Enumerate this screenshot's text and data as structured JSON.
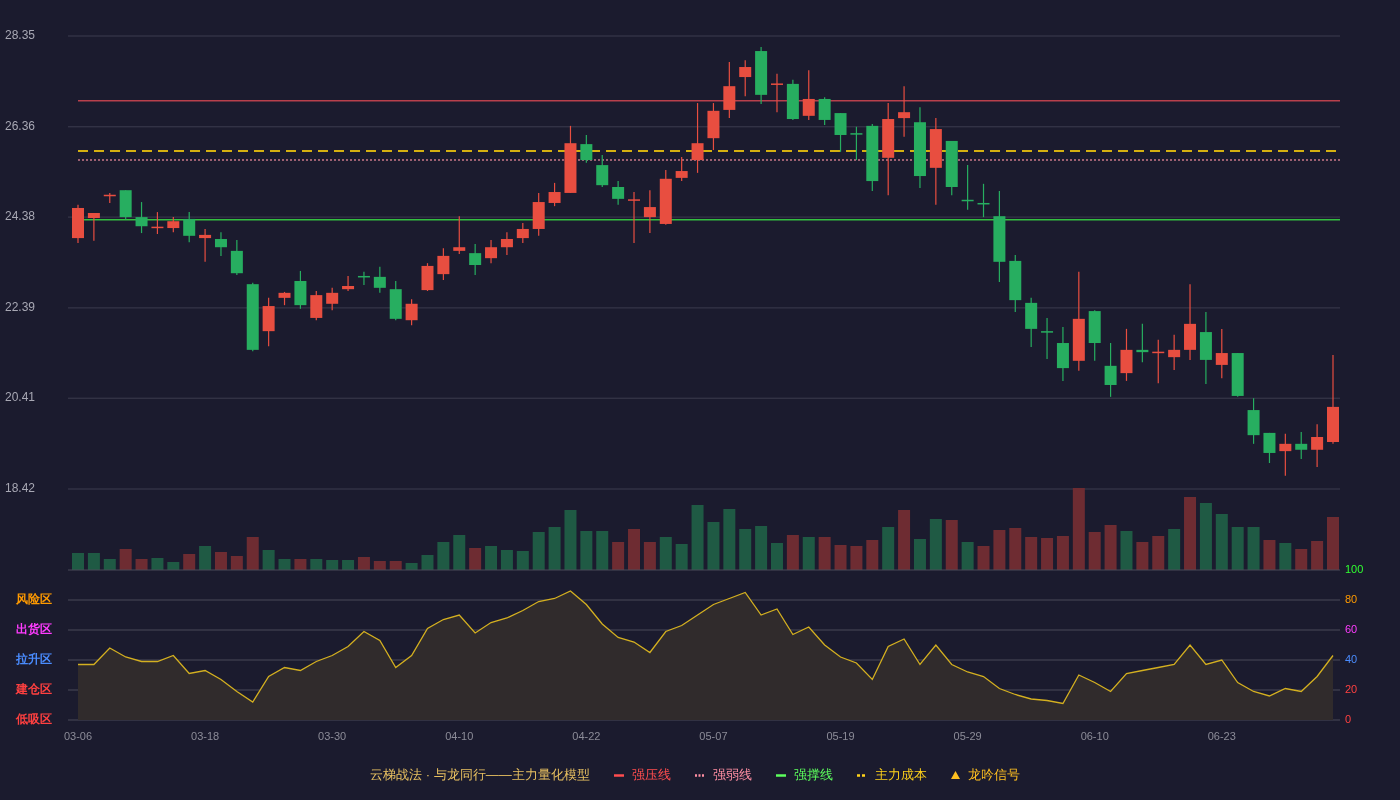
{
  "price_chart": {
    "chart_data": {
      "type": "candlestick",
      "ylim": [
        18.42,
        28.35
      ],
      "yticks": [
        {
          "value": 28.35,
          "label": "28.35"
        },
        {
          "value": 26.36,
          "label": "26.36"
        },
        {
          "value": 24.38,
          "label": "24.38"
        },
        {
          "value": 22.39,
          "label": "22.39"
        },
        {
          "value": 20.41,
          "label": "20.41"
        },
        {
          "value": 18.42,
          "label": "18.42"
        }
      ],
      "grid": true,
      "ohlc": [
        [
          23.92,
          24.65,
          23.81,
          24.58
        ],
        [
          24.36,
          24.47,
          23.86,
          24.47
        ],
        [
          24.86,
          24.91,
          24.69,
          24.87
        ],
        [
          24.97,
          24.97,
          24.32,
          24.38
        ],
        [
          24.38,
          24.71,
          24.03,
          24.18
        ],
        [
          24.16,
          24.49,
          24.01,
          24.17
        ],
        [
          24.14,
          24.38,
          24.05,
          24.29
        ],
        [
          24.34,
          24.49,
          23.83,
          23.97
        ],
        [
          23.92,
          24.12,
          23.4,
          23.99
        ],
        [
          23.9,
          24.05,
          23.53,
          23.72
        ],
        [
          23.64,
          23.88,
          23.11,
          23.15
        ],
        [
          22.91,
          22.94,
          21.44,
          21.47
        ],
        [
          21.88,
          22.61,
          21.55,
          22.43
        ],
        [
          22.61,
          22.74,
          22.45,
          22.72
        ],
        [
          22.98,
          23.2,
          22.37,
          22.45
        ],
        [
          22.17,
          22.76,
          22.12,
          22.67
        ],
        [
          22.48,
          22.83,
          22.34,
          22.72
        ],
        [
          22.8,
          23.09,
          22.76,
          22.87
        ],
        [
          23.09,
          23.18,
          22.89,
          23.08
        ],
        [
          23.07,
          23.29,
          22.72,
          22.83
        ],
        [
          22.8,
          22.98,
          22.12,
          22.15
        ],
        [
          22.12,
          22.58,
          22.01,
          22.48
        ],
        [
          22.78,
          23.37,
          22.76,
          23.31
        ],
        [
          23.13,
          23.7,
          23.0,
          23.53
        ],
        [
          23.64,
          24.4,
          23.57,
          23.72
        ],
        [
          23.59,
          23.79,
          23.11,
          23.33
        ],
        [
          23.48,
          23.88,
          23.37,
          23.72
        ],
        [
          23.72,
          24.05,
          23.55,
          23.9
        ],
        [
          23.92,
          24.25,
          23.81,
          24.12
        ],
        [
          24.12,
          24.91,
          23.97,
          24.71
        ],
        [
          24.69,
          25.13,
          24.62,
          24.93
        ],
        [
          24.91,
          26.38,
          24.91,
          26.0
        ],
        [
          25.98,
          26.18,
          25.57,
          25.63
        ],
        [
          25.52,
          25.74,
          25.04,
          25.08
        ],
        [
          25.04,
          25.17,
          24.65,
          24.78
        ],
        [
          24.76,
          24.93,
          23.81,
          24.77
        ],
        [
          24.38,
          24.97,
          24.03,
          24.6
        ],
        [
          24.23,
          25.41,
          24.21,
          25.22
        ],
        [
          25.24,
          25.7,
          25.17,
          25.39
        ],
        [
          25.63,
          26.88,
          25.35,
          26.0
        ],
        [
          26.11,
          26.88,
          25.85,
          26.71
        ],
        [
          26.73,
          27.78,
          26.55,
          27.25
        ],
        [
          27.45,
          27.82,
          27.03,
          27.67
        ],
        [
          28.02,
          28.11,
          26.86,
          27.06
        ],
        [
          27.3,
          27.52,
          26.68,
          27.31
        ],
        [
          27.3,
          27.39,
          26.51,
          26.53
        ],
        [
          26.6,
          27.6,
          26.51,
          26.97
        ],
        [
          26.97,
          27.01,
          26.4,
          26.51
        ],
        [
          26.66,
          26.66,
          25.81,
          26.18
        ],
        [
          26.22,
          26.36,
          25.63,
          26.21
        ],
        [
          26.38,
          26.42,
          24.95,
          25.17
        ],
        [
          25.68,
          26.88,
          24.86,
          26.53
        ],
        [
          26.55,
          27.25,
          26.14,
          26.68
        ],
        [
          26.46,
          26.79,
          25.02,
          25.28
        ],
        [
          25.46,
          26.55,
          24.65,
          26.31
        ],
        [
          26.05,
          26.05,
          24.86,
          25.04
        ],
        [
          24.76,
          25.52,
          24.54,
          24.75
        ],
        [
          24.69,
          25.11,
          24.38,
          24.68
        ],
        [
          24.4,
          24.95,
          22.96,
          23.4
        ],
        [
          23.42,
          23.55,
          22.3,
          22.56
        ],
        [
          22.5,
          22.61,
          21.53,
          21.93
        ],
        [
          21.88,
          22.17,
          21.27,
          21.87
        ],
        [
          21.62,
          21.97,
          20.79,
          21.07
        ],
        [
          21.23,
          23.18,
          21.01,
          22.15
        ],
        [
          22.32,
          22.34,
          21.23,
          21.62
        ],
        [
          21.12,
          21.62,
          20.44,
          20.7
        ],
        [
          20.96,
          21.93,
          20.79,
          21.47
        ],
        [
          21.47,
          22.04,
          21.2,
          21.42
        ],
        [
          21.42,
          21.69,
          20.74,
          21.43
        ],
        [
          21.31,
          21.8,
          21.03,
          21.47
        ],
        [
          21.47,
          22.91,
          21.25,
          22.04
        ],
        [
          21.86,
          22.3,
          20.72,
          21.25
        ],
        [
          21.14,
          21.93,
          20.85,
          21.4
        ],
        [
          21.4,
          21.4,
          20.44,
          20.46
        ],
        [
          20.15,
          20.41,
          19.41,
          19.6
        ],
        [
          19.65,
          19.65,
          18.99,
          19.21
        ],
        [
          19.25,
          19.63,
          18.71,
          19.41
        ],
        [
          19.41,
          19.67,
          19.08,
          19.28
        ],
        [
          19.28,
          19.84,
          18.9,
          19.56
        ],
        [
          19.45,
          21.36,
          19.41,
          20.22
        ]
      ],
      "ref_lines": [
        {
          "axis": "y",
          "value": 26.93
        },
        {
          "axis": "y",
          "value": 25.83
        },
        {
          "axis": "y",
          "value": 25.63
        },
        {
          "axis": "y",
          "value": 24.32
        }
      ]
    }
  },
  "indicator": {
    "zones": [
      {
        "label": "风险区",
        "color": "#ff9a00"
      },
      {
        "label": "出货区",
        "color": "#ff3cff"
      },
      {
        "label": "拉升区",
        "color": "#4a8cff"
      },
      {
        "label": "建仓区",
        "color": "#ff4040"
      },
      {
        "label": "低吸区",
        "color": "#ff4040"
      }
    ],
    "chart_data": {
      "type": "area",
      "categories": [
        "03-06",
        null,
        null,
        null,
        null,
        null,
        null,
        null,
        "03-18",
        null,
        null,
        null,
        null,
        null,
        null,
        null,
        "03-30",
        null,
        null,
        null,
        null,
        null,
        null,
        null,
        "04-10",
        null,
        null,
        null,
        null,
        null,
        null,
        null,
        "04-22",
        null,
        null,
        null,
        null,
        null,
        null,
        null,
        "05-07",
        null,
        null,
        null,
        null,
        null,
        null,
        null,
        "05-19",
        null,
        null,
        null,
        null,
        null,
        null,
        null,
        "05-29",
        null,
        null,
        null,
        null,
        null,
        null,
        null,
        "06-10",
        null,
        null,
        null,
        null,
        null,
        null,
        null,
        "06-23",
        null,
        null,
        null,
        null,
        null,
        null,
        null
      ],
      "ylim": [
        0,
        100
      ],
      "yticks": [
        100,
        80,
        60,
        40,
        20,
        0
      ],
      "grid": true,
      "series": [
        {
          "color": "#d4b020",
          "values": [
            37,
            37,
            48,
            42,
            39,
            39,
            43,
            31,
            33,
            27,
            19,
            12,
            29,
            35,
            33,
            39,
            43,
            49,
            59,
            53,
            35,
            43,
            61,
            67,
            70,
            58,
            65,
            68,
            73,
            79,
            81,
            86,
            77,
            64,
            55,
            52,
            45,
            59,
            63,
            70,
            77,
            81,
            85,
            70,
            74,
            57,
            62,
            50,
            42,
            38,
            27,
            49,
            54,
            37,
            50,
            37,
            32,
            29,
            21,
            17,
            14,
            13,
            11,
            30,
            25,
            19,
            31,
            33,
            35,
            37,
            50,
            37,
            40,
            25,
            19,
            16,
            21,
            19,
            29,
            43
          ]
        }
      ]
    }
  },
  "legend": {
    "title": "云梯战法 · 与龙同行——主力量化模型",
    "items": [
      {
        "label": "强压线",
        "kind": "solid",
        "color": "#ff4d4f"
      },
      {
        "label": "强弱线",
        "kind": "dotted",
        "color": "#ff8fa3"
      },
      {
        "label": "强撑线",
        "kind": "solid",
        "color": "#5dff5d"
      },
      {
        "label": "主力成本",
        "kind": "dashed",
        "color": "#ffd21a"
      },
      {
        "label": "龙吟信号",
        "kind": "triangle",
        "color": "#ffc020"
      }
    ]
  }
}
